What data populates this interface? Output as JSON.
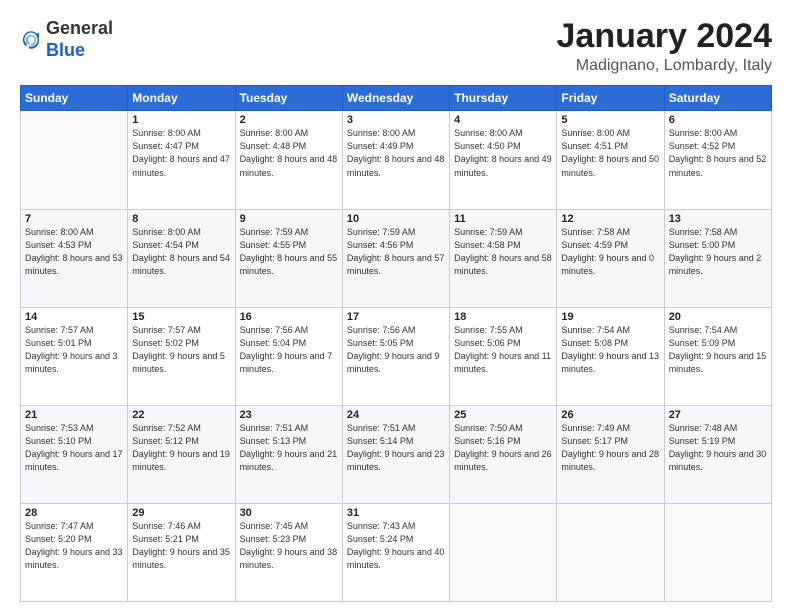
{
  "logo": {
    "general": "General",
    "blue": "Blue"
  },
  "header": {
    "month": "January 2024",
    "location": "Madignano, Lombardy, Italy"
  },
  "days_of_week": [
    "Sunday",
    "Monday",
    "Tuesday",
    "Wednesday",
    "Thursday",
    "Friday",
    "Saturday"
  ],
  "weeks": [
    [
      {
        "day": "",
        "sunrise": "",
        "sunset": "",
        "daylight": ""
      },
      {
        "day": "1",
        "sunrise": "Sunrise: 8:00 AM",
        "sunset": "Sunset: 4:47 PM",
        "daylight": "Daylight: 8 hours and 47 minutes."
      },
      {
        "day": "2",
        "sunrise": "Sunrise: 8:00 AM",
        "sunset": "Sunset: 4:48 PM",
        "daylight": "Daylight: 8 hours and 48 minutes."
      },
      {
        "day": "3",
        "sunrise": "Sunrise: 8:00 AM",
        "sunset": "Sunset: 4:49 PM",
        "daylight": "Daylight: 8 hours and 48 minutes."
      },
      {
        "day": "4",
        "sunrise": "Sunrise: 8:00 AM",
        "sunset": "Sunset: 4:50 PM",
        "daylight": "Daylight: 8 hours and 49 minutes."
      },
      {
        "day": "5",
        "sunrise": "Sunrise: 8:00 AM",
        "sunset": "Sunset: 4:51 PM",
        "daylight": "Daylight: 8 hours and 50 minutes."
      },
      {
        "day": "6",
        "sunrise": "Sunrise: 8:00 AM",
        "sunset": "Sunset: 4:52 PM",
        "daylight": "Daylight: 8 hours and 52 minutes."
      }
    ],
    [
      {
        "day": "7",
        "sunrise": "Sunrise: 8:00 AM",
        "sunset": "Sunset: 4:53 PM",
        "daylight": "Daylight: 8 hours and 53 minutes."
      },
      {
        "day": "8",
        "sunrise": "Sunrise: 8:00 AM",
        "sunset": "Sunset: 4:54 PM",
        "daylight": "Daylight: 8 hours and 54 minutes."
      },
      {
        "day": "9",
        "sunrise": "Sunrise: 7:59 AM",
        "sunset": "Sunset: 4:55 PM",
        "daylight": "Daylight: 8 hours and 55 minutes."
      },
      {
        "day": "10",
        "sunrise": "Sunrise: 7:59 AM",
        "sunset": "Sunset: 4:56 PM",
        "daylight": "Daylight: 8 hours and 57 minutes."
      },
      {
        "day": "11",
        "sunrise": "Sunrise: 7:59 AM",
        "sunset": "Sunset: 4:58 PM",
        "daylight": "Daylight: 8 hours and 58 minutes."
      },
      {
        "day": "12",
        "sunrise": "Sunrise: 7:58 AM",
        "sunset": "Sunset: 4:59 PM",
        "daylight": "Daylight: 9 hours and 0 minutes."
      },
      {
        "day": "13",
        "sunrise": "Sunrise: 7:58 AM",
        "sunset": "Sunset: 5:00 PM",
        "daylight": "Daylight: 9 hours and 2 minutes."
      }
    ],
    [
      {
        "day": "14",
        "sunrise": "Sunrise: 7:57 AM",
        "sunset": "Sunset: 5:01 PM",
        "daylight": "Daylight: 9 hours and 3 minutes."
      },
      {
        "day": "15",
        "sunrise": "Sunrise: 7:57 AM",
        "sunset": "Sunset: 5:02 PM",
        "daylight": "Daylight: 9 hours and 5 minutes."
      },
      {
        "day": "16",
        "sunrise": "Sunrise: 7:56 AM",
        "sunset": "Sunset: 5:04 PM",
        "daylight": "Daylight: 9 hours and 7 minutes."
      },
      {
        "day": "17",
        "sunrise": "Sunrise: 7:56 AM",
        "sunset": "Sunset: 5:05 PM",
        "daylight": "Daylight: 9 hours and 9 minutes."
      },
      {
        "day": "18",
        "sunrise": "Sunrise: 7:55 AM",
        "sunset": "Sunset: 5:06 PM",
        "daylight": "Daylight: 9 hours and 11 minutes."
      },
      {
        "day": "19",
        "sunrise": "Sunrise: 7:54 AM",
        "sunset": "Sunset: 5:08 PM",
        "daylight": "Daylight: 9 hours and 13 minutes."
      },
      {
        "day": "20",
        "sunrise": "Sunrise: 7:54 AM",
        "sunset": "Sunset: 5:09 PM",
        "daylight": "Daylight: 9 hours and 15 minutes."
      }
    ],
    [
      {
        "day": "21",
        "sunrise": "Sunrise: 7:53 AM",
        "sunset": "Sunset: 5:10 PM",
        "daylight": "Daylight: 9 hours and 17 minutes."
      },
      {
        "day": "22",
        "sunrise": "Sunrise: 7:52 AM",
        "sunset": "Sunset: 5:12 PM",
        "daylight": "Daylight: 9 hours and 19 minutes."
      },
      {
        "day": "23",
        "sunrise": "Sunrise: 7:51 AM",
        "sunset": "Sunset: 5:13 PM",
        "daylight": "Daylight: 9 hours and 21 minutes."
      },
      {
        "day": "24",
        "sunrise": "Sunrise: 7:51 AM",
        "sunset": "Sunset: 5:14 PM",
        "daylight": "Daylight: 9 hours and 23 minutes."
      },
      {
        "day": "25",
        "sunrise": "Sunrise: 7:50 AM",
        "sunset": "Sunset: 5:16 PM",
        "daylight": "Daylight: 9 hours and 26 minutes."
      },
      {
        "day": "26",
        "sunrise": "Sunrise: 7:49 AM",
        "sunset": "Sunset: 5:17 PM",
        "daylight": "Daylight: 9 hours and 28 minutes."
      },
      {
        "day": "27",
        "sunrise": "Sunrise: 7:48 AM",
        "sunset": "Sunset: 5:19 PM",
        "daylight": "Daylight: 9 hours and 30 minutes."
      }
    ],
    [
      {
        "day": "28",
        "sunrise": "Sunrise: 7:47 AM",
        "sunset": "Sunset: 5:20 PM",
        "daylight": "Daylight: 9 hours and 33 minutes."
      },
      {
        "day": "29",
        "sunrise": "Sunrise: 7:46 AM",
        "sunset": "Sunset: 5:21 PM",
        "daylight": "Daylight: 9 hours and 35 minutes."
      },
      {
        "day": "30",
        "sunrise": "Sunrise: 7:45 AM",
        "sunset": "Sunset: 5:23 PM",
        "daylight": "Daylight: 9 hours and 38 minutes."
      },
      {
        "day": "31",
        "sunrise": "Sunrise: 7:43 AM",
        "sunset": "Sunset: 5:24 PM",
        "daylight": "Daylight: 9 hours and 40 minutes."
      },
      {
        "day": "",
        "sunrise": "",
        "sunset": "",
        "daylight": ""
      },
      {
        "day": "",
        "sunrise": "",
        "sunset": "",
        "daylight": ""
      },
      {
        "day": "",
        "sunrise": "",
        "sunset": "",
        "daylight": ""
      }
    ]
  ]
}
